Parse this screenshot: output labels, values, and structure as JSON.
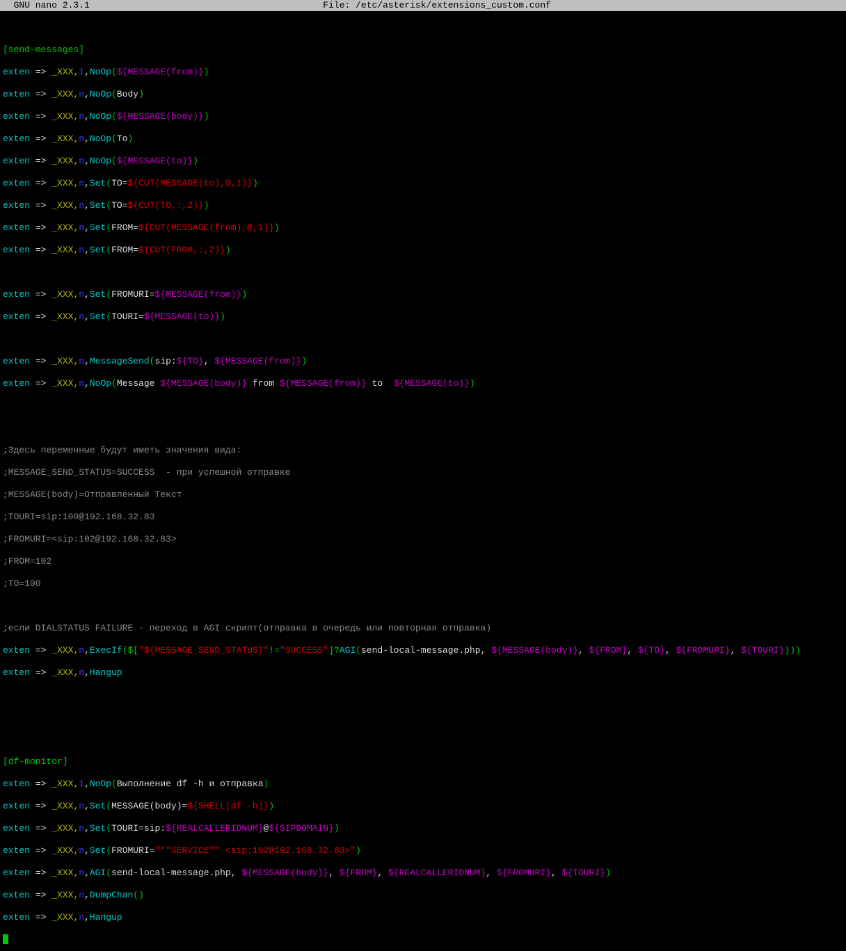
{
  "title_left": "  GNU nano 2.3.1",
  "title_file": "File: /etc/asterisk/extensions_custom.conf",
  "lines": {
    "ctx_send": "[send-messages]",
    "ext": "exten",
    "arrow": " => ",
    "xxx_c": "_XXX,",
    "one": "1",
    "n": "n",
    "comma": ",",
    "NoOp": "NoOp",
    "Set": "Set",
    "MessageSend": "MessageSend",
    "ExecIf": "ExecIf",
    "Hangup": "Hangup",
    "AGI": "AGI",
    "DumpChan": "DumpChan",
    "open": "(",
    "close": ")",
    "msg_from": "${MESSAGE(from)}",
    "msg_body": "${MESSAGE(body)}",
    "msg_to": "${MESSAGE(to)}",
    "body_txt": "Body",
    "to_txt": "To",
    "set_open": "(",
    "to_eq": "TO=",
    "from_eq": "FROM=",
    "fromuri_eq": "FROMURI=",
    "touri_eq": "TOURI=",
    "cut_msg_to": "${CUT(MESSAGE(to),@,1)}",
    "cut_to": "${CUT(TO,:,2)}",
    "cut_msg_from": "${CUT(MESSAGE(from),@,1)}",
    "cut_from": "${CUT(FROM,:,2)}",
    "sip_pfx": "sip:",
    "sip_to": "${TO}",
    "sep_cs": ", ",
    "message_lit": "Message ",
    "from_lit": " from ",
    "to_lit": " to  ",
    "cmt1": ";Здесь переменные будут иметь значения вида:",
    "cmt2": ";MESSAGE_SEND_STATUS=SUCCESS  - при успешной отправке",
    "cmt3": ";MESSAGE(body)=Отправленный Текст",
    "cmt4": ";TOURI=sip:100@192.168.32.83",
    "cmt5": ";FROMURI=<sip:102@192.168.32.83>",
    "cmt6": ";FROM=102",
    "cmt7": ";TO=100",
    "cmt8": ";если DIALSTATUS FAILURE - переход в AGI скрипт(отправка в очередь или повторная отправка)",
    "execif_open": "($[",
    "q1": "\"${MESSAGE_SEND_STATUS}\"",
    "neq": "!=",
    "q2": "\"SUCCESS\"",
    "execif_mid": "]?",
    "agi_name": "send-local-message.php, ",
    "v_from": "${FROM}",
    "v_to": "${TO}",
    "v_fromuri": "${FROMURI}",
    "v_touri": "${TOURI}",
    "ctx_df": "[df-monitor]",
    "df_noop_txt": "Выполнение df -h и отправка",
    "msgbody_eq": "MESSAGE(body)=",
    "shell_df": "${SHELL(df -h)}",
    "touri_sip": "TOURI=sip:",
    "realcid": "${REALCALLERIDNUM}",
    "at": "@",
    "sipdomain": "${SIPDOMAIN}",
    "fromuri_svc_pre": "FROMURI=",
    "fromuri_svc_q": "\"\"\"SERVICE\"\" <sip:102@192.168.32.83>\"",
    "close2": "))",
    "triple_close": ")))"
  }
}
